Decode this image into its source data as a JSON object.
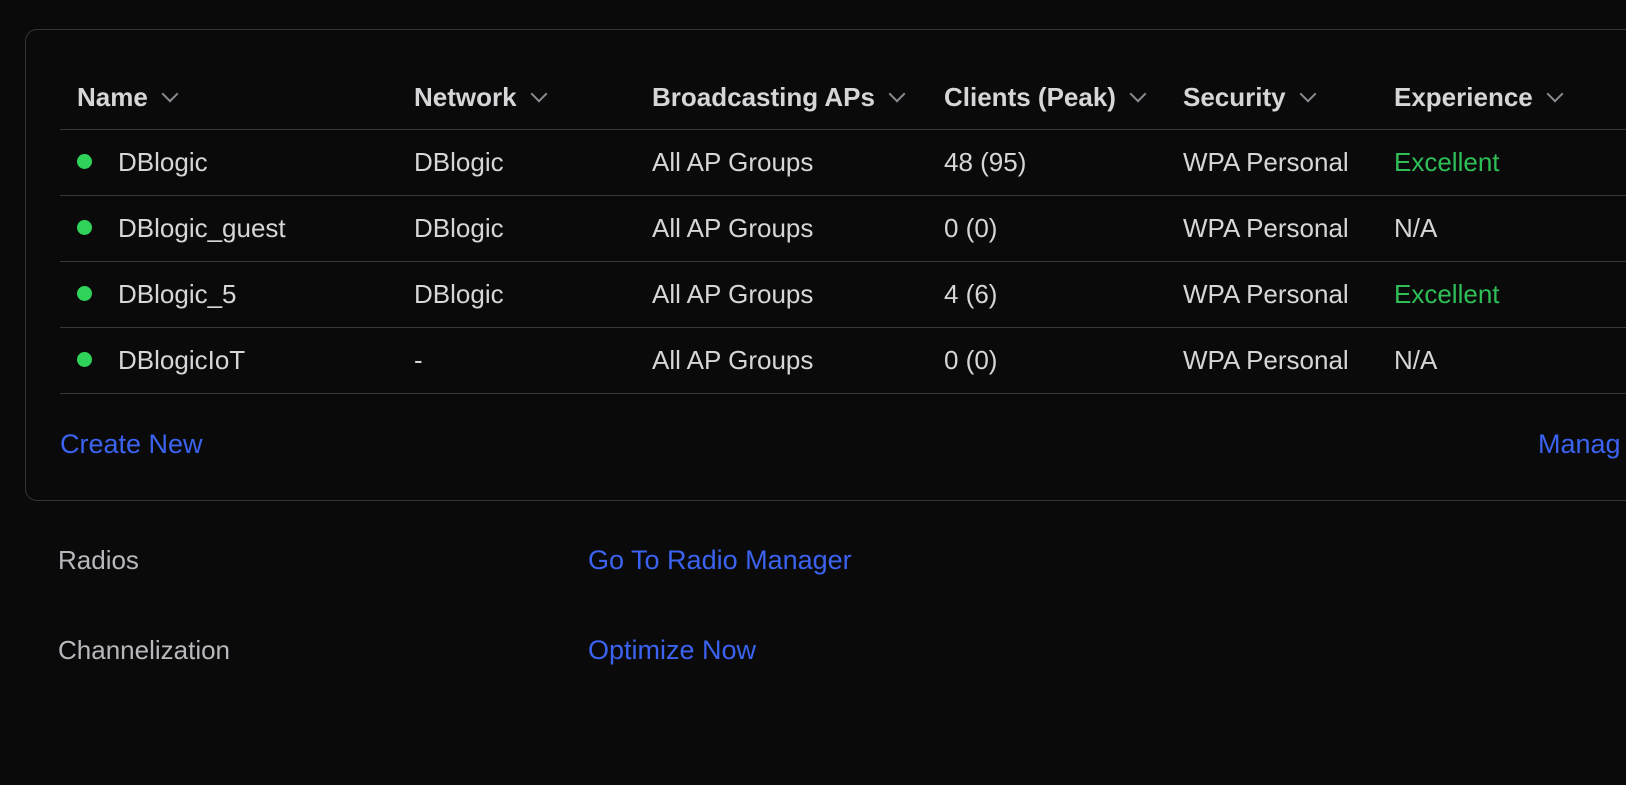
{
  "table": {
    "columns": [
      {
        "key": "name",
        "label": "Name"
      },
      {
        "key": "network",
        "label": "Network"
      },
      {
        "key": "broadcasting",
        "label": "Broadcasting APs"
      },
      {
        "key": "clients",
        "label": "Clients (Peak)"
      },
      {
        "key": "security",
        "label": "Security"
      },
      {
        "key": "experience",
        "label": "Experience"
      }
    ],
    "rows": [
      {
        "status_color": "#2fd35a",
        "name": "DBlogic",
        "network": "DBlogic",
        "broadcasting": "All AP Groups",
        "clients": "48 (95)",
        "security": "WPA Personal",
        "experience": "Excellent",
        "experience_color": "#2fbf57"
      },
      {
        "status_color": "#2fd35a",
        "name": "DBlogic_guest",
        "network": "DBlogic",
        "broadcasting": "All AP Groups",
        "clients": "0 (0)",
        "security": "WPA Personal",
        "experience": "N/A",
        "experience_color": "#d6d6d8"
      },
      {
        "status_color": "#2fd35a",
        "name": "DBlogic_5",
        "network": "DBlogic",
        "broadcasting": "All AP Groups",
        "clients": "4 (6)",
        "security": "WPA Personal",
        "experience": "Excellent",
        "experience_color": "#2fbf57"
      },
      {
        "status_color": "#2fd35a",
        "name": "DBlogicIoT",
        "network": "-",
        "broadcasting": "All AP Groups",
        "clients": "0 (0)",
        "security": "WPA Personal",
        "experience": "N/A",
        "experience_color": "#d6d6d8"
      }
    ]
  },
  "card_actions": {
    "create_new": "Create New",
    "manage": "Manag"
  },
  "settings": [
    {
      "label": "Radios",
      "action": "Go To Radio Manager"
    },
    {
      "label": "Channelization",
      "action": "Optimize Now"
    }
  ],
  "colors": {
    "link": "#3b63f0",
    "status_ok": "#2fd35a",
    "excellent": "#2fbf57"
  }
}
